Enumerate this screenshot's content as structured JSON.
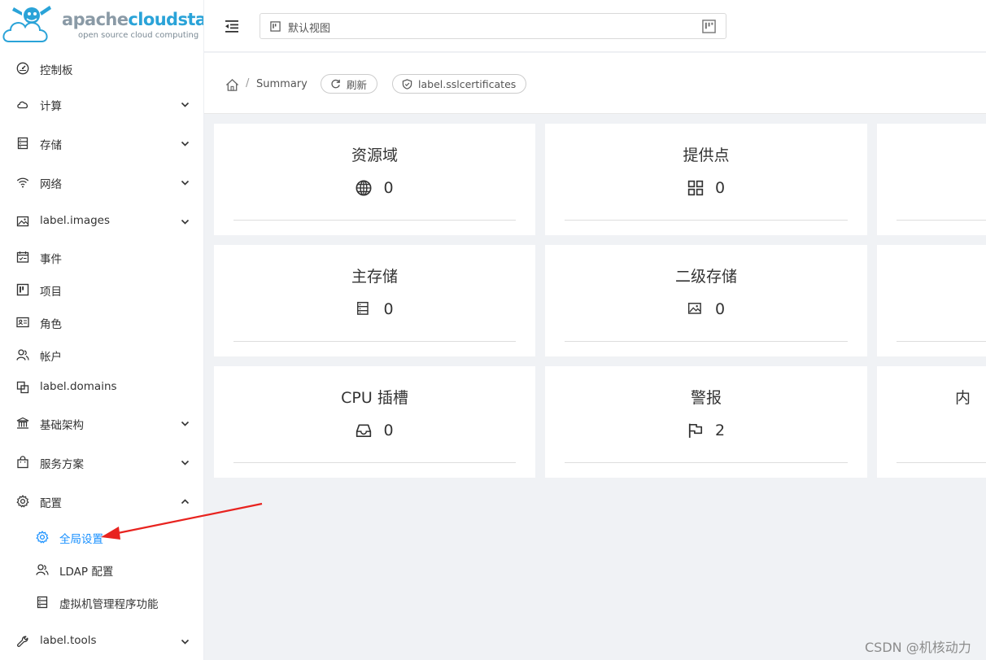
{
  "brand": {
    "name_part1": "apache",
    "name_part2": "cloudstack",
    "tagline": "open source cloud computing"
  },
  "sidebar": {
    "items": [
      {
        "label": "控制板",
        "icon": "dashboard-icon",
        "expandable": false
      },
      {
        "label": "计算",
        "icon": "cloud-icon",
        "expandable": true
      },
      {
        "label": "存储",
        "icon": "storage-icon",
        "expandable": true
      },
      {
        "label": "网络",
        "icon": "wifi-icon",
        "expandable": true
      },
      {
        "label": "label.images",
        "icon": "picture-icon",
        "expandable": true
      },
      {
        "label": "事件",
        "icon": "schedule-icon",
        "expandable": false
      },
      {
        "label": "项目",
        "icon": "project-icon",
        "expandable": false
      },
      {
        "label": "角色",
        "icon": "idcard-icon",
        "expandable": false
      },
      {
        "label": "帐户",
        "icon": "team-icon",
        "expandable": false
      },
      {
        "label": "label.domains",
        "icon": "block-icon",
        "expandable": false
      },
      {
        "label": "基础架构",
        "icon": "bank-icon",
        "expandable": true
      },
      {
        "label": "服务方案",
        "icon": "shopping-icon",
        "expandable": true
      },
      {
        "label": "配置",
        "icon": "setting-icon",
        "expandable": true,
        "expanded": true
      },
      {
        "label": "全局设置",
        "icon": "setting-icon",
        "sub": true,
        "active": true
      },
      {
        "label": "LDAP 配置",
        "icon": "team-icon",
        "sub": true
      },
      {
        "label": "虚拟机管理程序功能",
        "icon": "database-icon",
        "sub": true
      },
      {
        "label": "label.tools",
        "icon": "tool-icon",
        "expandable": true
      }
    ]
  },
  "header": {
    "project_select": "默认视图"
  },
  "breadcrumb": {
    "current": "Summary",
    "refresh_label": "刷新",
    "ssl_label": "label.sslcertificates"
  },
  "cards": [
    {
      "title": "资源域",
      "value": "0",
      "icon": "global-icon"
    },
    {
      "title": "提供点",
      "value": "0",
      "icon": "appstore-icon"
    },
    {
      "title": "",
      "value": "",
      "icon": ""
    },
    {
      "title": "主存储",
      "value": "0",
      "icon": "database-icon"
    },
    {
      "title": "二级存储",
      "value": "0",
      "icon": "picture-icon"
    },
    {
      "title": "",
      "value": "",
      "icon": ""
    },
    {
      "title": "CPU 插槽",
      "value": "0",
      "icon": "inbox-icon"
    },
    {
      "title": "警报",
      "value": "2",
      "icon": "flag-icon"
    },
    {
      "title": "内",
      "value": "",
      "icon": ""
    }
  ],
  "watermark": "CSDN @机核动力",
  "colors": {
    "accent": "#1890ff",
    "annotation_arrow": "#e8231f",
    "brand_blue": "#2aa3d8"
  }
}
